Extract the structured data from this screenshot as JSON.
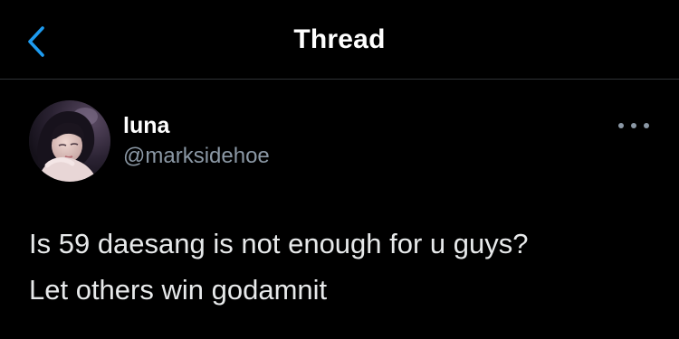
{
  "nav": {
    "title": "Thread",
    "back_icon": "chevron-left-icon",
    "accent_color": "#1d9bf0"
  },
  "tweet": {
    "author_name": "luna",
    "author_handle": "@marksidehoe",
    "avatar_icon": "profile-photo",
    "more_icon": "more-horizontal-icon",
    "text_lines": [
      "Is 59 daesang is not enough for u guys?",
      "Let others win godamnit"
    ]
  },
  "colors": {
    "background": "#000000",
    "text": "#e7e9ea",
    "secondary_text": "#8b98a5",
    "divider": "#2f3336"
  }
}
